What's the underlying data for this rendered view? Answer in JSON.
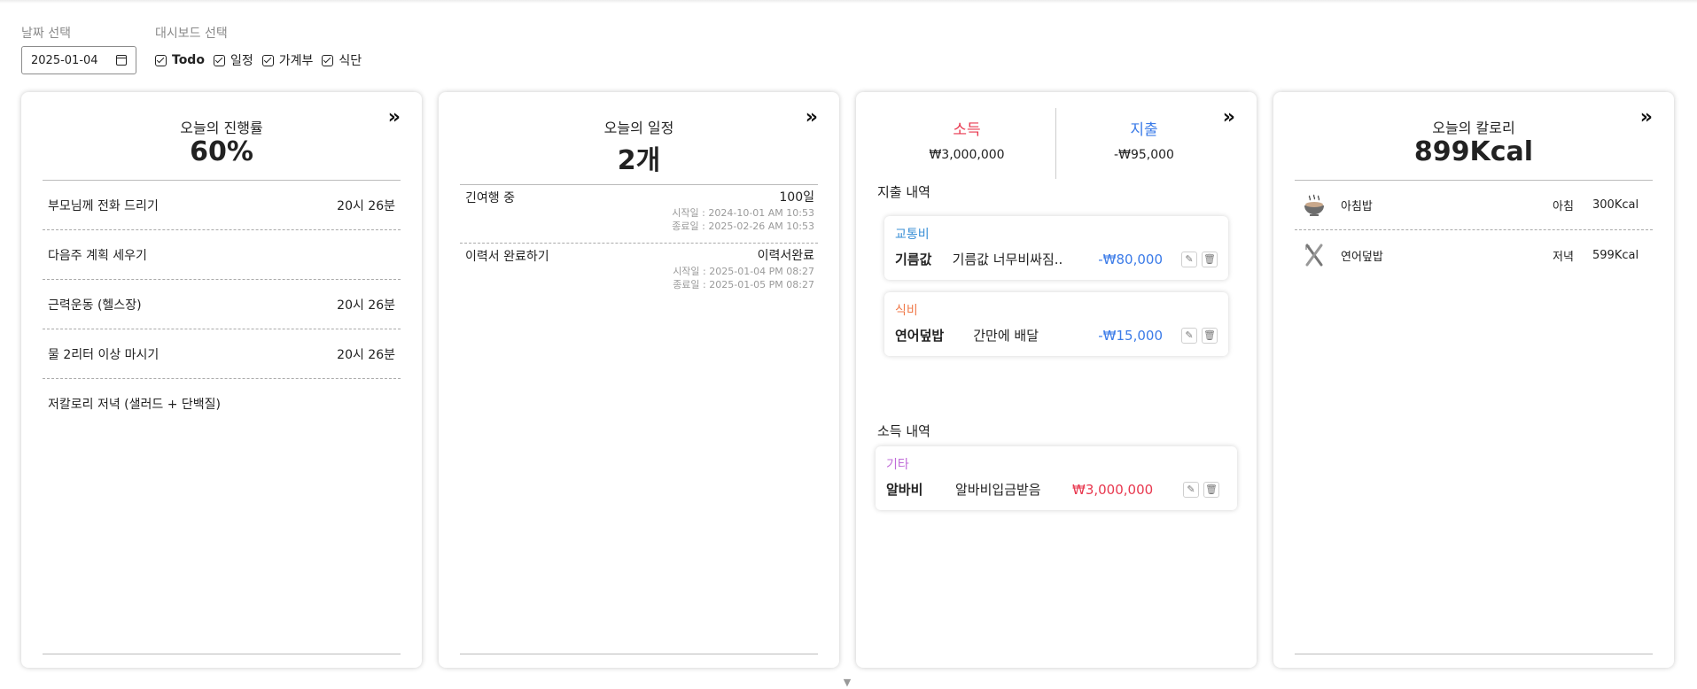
{
  "controls": {
    "date_label": "날짜 선택",
    "date_value": "2025-01-04",
    "dashboard_label": "대시보드 선택",
    "checkboxes": [
      {
        "label": "Todo"
      },
      {
        "label": "일정"
      },
      {
        "label": "가계부"
      },
      {
        "label": "식단"
      }
    ]
  },
  "todo": {
    "title": "오늘의 진행률",
    "progress": "60%",
    "items": [
      {
        "text": "부모님께 전화 드리기",
        "time": "20시 26분"
      },
      {
        "text": "다음주 계획 세우기",
        "time": ""
      },
      {
        "text": "근력운동 (헬스장)",
        "time": "20시 26분"
      },
      {
        "text": "물 2리터 이상 마시기",
        "time": "20시 26분"
      },
      {
        "text": "저칼로리 저녁 (샐러드 + 단백질)",
        "time": ""
      }
    ]
  },
  "schedule": {
    "title": "오늘의 일정",
    "count": "2개",
    "items": [
      {
        "name": "긴여행 중",
        "status": "100일",
        "start": "시작일 : 2024-10-01 AM 10:53",
        "end": "종료일 : 2025-02-26 AM 10:53"
      },
      {
        "name": "이력서 완료하기",
        "status": "이력서완료",
        "start": "시작일 : 2025-01-04 PM 08:27",
        "end": "종료일 : 2025-01-05 PM 08:27"
      }
    ]
  },
  "ledger": {
    "income_label": "소득",
    "income_amount": "₩3,000,000",
    "expense_label": "지출",
    "expense_amount": "-₩95,000",
    "expense_section": "지출 내역",
    "income_section": "소득 내역",
    "expenses": [
      {
        "category": "교통비",
        "name": "기름값",
        "memo": "기름값 너무비싸짐..",
        "amount": "-₩80,000"
      },
      {
        "category": "식비",
        "name": "연어덮밥",
        "memo": "간만에 배달",
        "amount": "-₩15,000"
      }
    ],
    "incomes": [
      {
        "category": "기타",
        "name": "알바비",
        "memo": "알바비입금받음",
        "amount": "₩3,000,000"
      }
    ],
    "colors": {
      "income": "#e8384f",
      "expense": "#3b7be8",
      "cat_transport": "#3a8fd6",
      "cat_food": "#f07a4a",
      "cat_etc": "#c06bd8"
    }
  },
  "meals": {
    "title": "오늘의 칼로리",
    "total": "899Kcal",
    "items": [
      {
        "name": "아침밥",
        "time": "아침",
        "kcal": "300Kcal",
        "icon": "rice-bowl-icon"
      },
      {
        "name": "연어덮밥",
        "time": "저녁",
        "kcal": "599Kcal",
        "icon": "fork-knife-icon"
      }
    ]
  },
  "icons": {
    "expand": "double-chevron-right-icon",
    "edit": "pencil-icon",
    "delete": "trash-icon",
    "scroll": "chevron-down-icon"
  }
}
